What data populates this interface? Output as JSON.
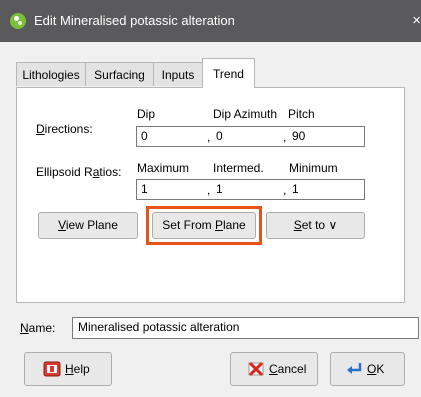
{
  "window": {
    "title": "Edit Mineralised potassic alteration",
    "close_glyph": "×",
    "app_icon": "leapfrog-icon"
  },
  "tabs": [
    {
      "label": "Lithologies",
      "active": false
    },
    {
      "label": "Surfacing",
      "active": false
    },
    {
      "label": "Inputs",
      "active": false
    },
    {
      "label": "Trend",
      "active": true
    }
  ],
  "trend": {
    "directions": {
      "label_mnemonic": "D",
      "label_rest": "irections:",
      "headers": [
        "Dip",
        "Dip Azimuth",
        "Pitch"
      ],
      "values": [
        "0",
        "0",
        "90"
      ]
    },
    "ellipsoid": {
      "label_pre": "Ellipsoid R",
      "label_mnemonic": "a",
      "label_rest": "tios:",
      "headers": [
        "Maximum",
        "Intermed.",
        "Minimum"
      ],
      "values": [
        "1",
        "1",
        "1"
      ]
    },
    "separator": ",",
    "buttons": {
      "view_plane": {
        "mnemonic": "V",
        "rest": "iew Plane"
      },
      "set_from_plane": {
        "pre": "Set From ",
        "mnemonic": "P",
        "rest": "lane"
      },
      "set_to": {
        "mnemonic": "S",
        "rest": "et to",
        "chevron": "∨"
      }
    }
  },
  "name": {
    "label_mnemonic": "N",
    "label_rest": "ame:",
    "value": "Mineralised potassic alteration"
  },
  "footer": {
    "help": {
      "mnemonic": "H",
      "rest": "elp",
      "icon": "help-icon"
    },
    "cancel": {
      "mnemonic": "C",
      "rest": "ancel",
      "icon": "cancel-icon"
    },
    "ok": {
      "mnemonic": "O",
      "rest": "K",
      "icon": "ok-icon"
    }
  },
  "colors": {
    "title_bar": "#5a5a5c",
    "highlight": "#e8531b",
    "app_icon": "#7bbf3a"
  }
}
